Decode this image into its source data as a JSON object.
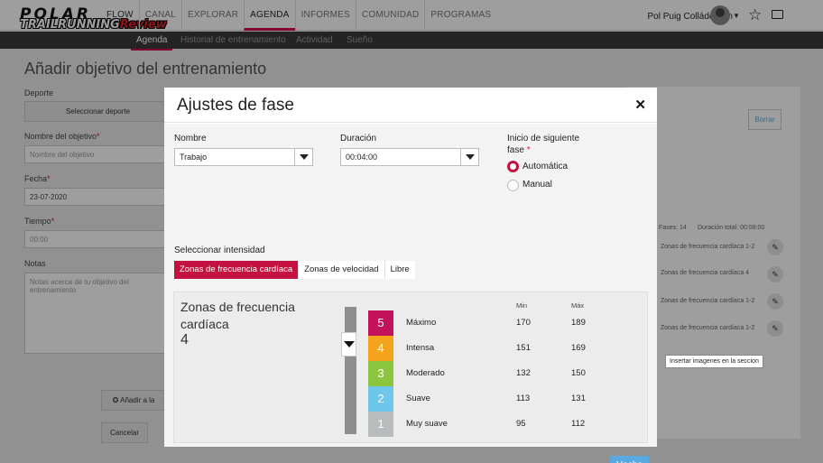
{
  "brand": {
    "logo_top": "POLAR",
    "logo_bottom_a": "TRAILRUNNING",
    "logo_bottom_b": "Review"
  },
  "nav": {
    "items": [
      {
        "label": "FLOW"
      },
      {
        "label": "CANAL"
      },
      {
        "label": "EXPLORAR"
      },
      {
        "label": "AGENDA",
        "active": true
      },
      {
        "label": "INFORMES"
      },
      {
        "label": "COMUNIDAD"
      },
      {
        "label": "PROGRAMAS"
      }
    ],
    "user_name": "Pol Puig Colláderram"
  },
  "subnav": {
    "items": [
      {
        "label": "Agenda",
        "active": true
      },
      {
        "label": "Historial de entrenamiento"
      },
      {
        "label": "Actividad"
      },
      {
        "label": "Sueño"
      }
    ]
  },
  "background": {
    "page_title": "Añadir objetivo del entrenamiento",
    "sport_label": "Deporte",
    "sport_button": "Seleccionar deporte",
    "name_label": "Nombre del objetivo",
    "name_placeholder": "Nombre del objetivo",
    "date_label": "Fecha",
    "date_value": "23-07-2020",
    "time_label": "Tiempo",
    "time_value": "00:00",
    "notes_label": "Notas",
    "notes_placeholder": "Notas acerca de tu objetivo del entrenamiento",
    "add_button": "Añadir a la",
    "cancel_button": "Cancelar",
    "clear_button": "Borrar",
    "summary_phases": "Fases: 14",
    "summary_total": "Duración total: 00:08:00",
    "list": [
      "Zonas de frecuencia cardíaca 1-2",
      "Zonas de frecuencia cardíaca 4",
      "Zonas de frecuencia cardíaca 1-2",
      "Zonas de frecuencia cardíaca 1-2"
    ]
  },
  "tooltip": "Insertar imagenes en la seccion",
  "modal": {
    "title": "Ajustes de fase",
    "close_icon": "close-icon",
    "name_label": "Nombre",
    "name_value": "Trabajo",
    "duration_label": "Duración",
    "duration_value": "00:04:00",
    "next_phase_label_1": "Inicio de siguiente",
    "next_phase_label_2": "fase",
    "required_mark": "*",
    "radio_auto": "Automática",
    "radio_manual": "Manual",
    "intensity_label": "Seleccionar intensidad",
    "tabs": [
      {
        "label": "Zonas de frecuencia cardíaca",
        "active": true
      },
      {
        "label": "Zonas de velocidad"
      },
      {
        "label": "Libre"
      }
    ],
    "zone_title": "Zonas de frecuencia cardíaca",
    "zone_value": "4",
    "col_min": "Min",
    "col_max": "Máx",
    "zones": [
      {
        "num": "5",
        "name": "Máximo",
        "min": "170",
        "max": "189",
        "color": "#c3125a"
      },
      {
        "num": "4",
        "name": "Intensa",
        "min": "151",
        "max": "169",
        "color": "#f4a41c"
      },
      {
        "num": "3",
        "name": "Moderado",
        "min": "132",
        "max": "150",
        "color": "#8cc63f"
      },
      {
        "num": "2",
        "name": "Suave",
        "min": "113",
        "max": "131",
        "color": "#6ec6ea"
      },
      {
        "num": "1",
        "name": "Muy suave",
        "min": "95",
        "max": "112",
        "color": "#b8bcbc"
      }
    ],
    "done_button": "Hecho"
  }
}
